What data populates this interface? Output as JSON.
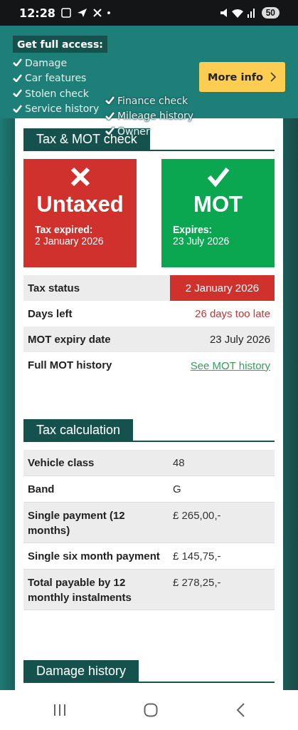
{
  "status_bar": {
    "time": "12:28",
    "battery": "50"
  },
  "promo": {
    "title": "Get full access:",
    "features_left": [
      "Damage",
      "Car features",
      "Stolen check",
      "Service history"
    ],
    "features_right": [
      "Finance check",
      "Mileage history",
      "Owner"
    ],
    "button": "More info"
  },
  "tax_mot": {
    "title": "Tax & MOT check",
    "tiles": [
      {
        "kind": "bad",
        "title": "Untaxed",
        "label": "Tax expired:",
        "value": "2 January 2026"
      },
      {
        "kind": "good",
        "title": "MOT",
        "label": "Expires:",
        "value": "23 July 2026"
      }
    ],
    "rows": [
      {
        "label": "Tax status",
        "value": "2 January 2026",
        "kind": "alert"
      },
      {
        "label": "Days left",
        "value": "26 days too late",
        "kind": "warning"
      },
      {
        "label": "MOT expiry date",
        "value": "23 July 2026",
        "kind": "plain"
      },
      {
        "label": "Full MOT history",
        "value": "See MOT history",
        "kind": "link"
      }
    ]
  },
  "tax_calculation": {
    "title": "Tax calculation",
    "rows": [
      {
        "label": "Vehicle class",
        "value": "48"
      },
      {
        "label": "Band",
        "value": "G"
      },
      {
        "label": "Single payment (12 months)",
        "value": "£ 265,00,-"
      },
      {
        "label": "Single six month payment",
        "value": "£ 145,75,-"
      },
      {
        "label": "Total payable by 12 monthly instalments",
        "value": "£ 278,25,-"
      }
    ]
  },
  "next_section": {
    "title": "Damage history"
  }
}
